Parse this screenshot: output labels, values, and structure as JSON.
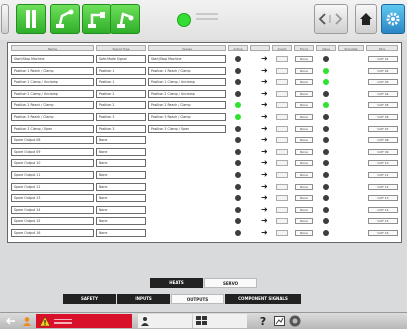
{
  "topbar": {
    "back_icon": "back-arrow-icon",
    "forward_icon": "forward-arrow-icon",
    "home_icon": "home-icon",
    "settings_icon": "gear-icon"
  },
  "table": {
    "headers": [
      "Name",
      "Signal Type",
      "Values",
      "Active",
      "",
      "Invert",
      "Force",
      "Value",
      "Simulate",
      "Pins"
    ]
  },
  "rows": [
    {
      "name": "Start/Stop Machine",
      "type": "Safe-Mode Signal",
      "value": "Start/Stop Machine",
      "state": "dark",
      "force": "None",
      "val": "dark",
      "pin": "OUT 01"
    },
    {
      "name": "Position 1 Reach / Clamp",
      "type": "Position 1",
      "value": "Position 1 Reach / Clamp",
      "state": "dark",
      "force": "None",
      "val": "on",
      "pin": "OUT 02"
    },
    {
      "name": "Position 1 Clamp / Unclamp",
      "type": "Position 1",
      "value": "Position 1 Clamp / Unclamp",
      "state": "dark",
      "force": "None",
      "val": "on",
      "pin": "OUT 03"
    },
    {
      "name": "Position 2 Clamp / Unclamp",
      "type": "Position 2",
      "value": "Position 2 Clamp / Unclamp",
      "state": "dark",
      "force": "None",
      "val": "dark",
      "pin": "OUT 04"
    },
    {
      "name": "Position 2 Reach / Clamp",
      "type": "Position 2",
      "value": "Position 2 Reach / Clamp",
      "state": "on",
      "force": "None",
      "val": "on",
      "pin": "OUT 05"
    },
    {
      "name": "Position 3 Reach / Clamp",
      "type": "Position 3",
      "value": "Position 3 Reach / Clamp",
      "state": "on",
      "force": "None",
      "val": "dark",
      "pin": "OUT 06"
    },
    {
      "name": "Position 3 Clamp / Open",
      "type": "Position 3",
      "value": "Position 3 Clamp / Open",
      "state": "dark",
      "force": "None",
      "val": "dark",
      "pin": "OUT 07"
    },
    {
      "name": "Spare Output 08",
      "type": "None",
      "value": "",
      "state": "dark",
      "force": "None",
      "val": "dark",
      "pin": "OUT 08"
    },
    {
      "name": "Spare Output 09",
      "type": "None",
      "value": "",
      "state": "dark",
      "force": "None",
      "val": "dark",
      "pin": "OUT 09"
    },
    {
      "name": "Spare Output 10",
      "type": "None",
      "value": "",
      "state": "dark",
      "force": "None",
      "val": "dark",
      "pin": "OUT 10"
    },
    {
      "name": "Spare Output 11",
      "type": "None",
      "value": "",
      "state": "dark",
      "force": "None",
      "val": "dark",
      "pin": "OUT 11"
    },
    {
      "name": "Spare Output 12",
      "type": "None",
      "value": "",
      "state": "dark",
      "force": "None",
      "val": "dark",
      "pin": "OUT 12"
    },
    {
      "name": "Spare Output 13",
      "type": "None",
      "value": "",
      "state": "dark",
      "force": "None",
      "val": "dark",
      "pin": "OUT 13"
    },
    {
      "name": "Spare Output 14",
      "type": "None",
      "value": "",
      "state": "dark",
      "force": "None",
      "val": "dark",
      "pin": "OUT 14"
    },
    {
      "name": "Spare Output 15",
      "type": "None",
      "value": "",
      "state": "dark",
      "force": "None",
      "val": "dark",
      "pin": "OUT 15"
    },
    {
      "name": "Spare Output 16",
      "type": "None",
      "value": "",
      "state": "dark",
      "force": "None",
      "val": "dark",
      "pin": "OUT 16"
    }
  ],
  "toggles": {
    "heats": "HEATS",
    "servo": "SERVO",
    "safety": "SAFETY",
    "inputs": "INPUTS",
    "outputs": "OUTPUTS",
    "component_signals": "COMPONENT SIGNALS"
  },
  "bottombar": {
    "help": "?"
  },
  "colors": {
    "green": "#2fae2a",
    "alarm_red": "#d8102a",
    "indicator_on": "#2ee32e"
  }
}
